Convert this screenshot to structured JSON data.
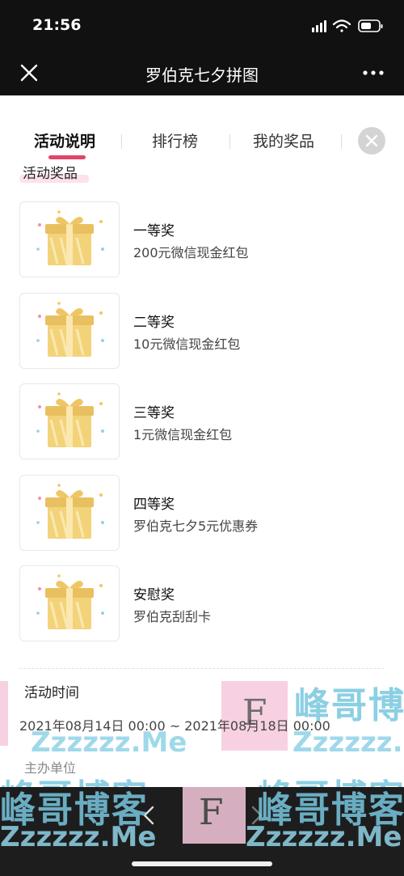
{
  "status_bar": {
    "time": "21:56"
  },
  "nav": {
    "title": "罗伯克七夕拼图"
  },
  "tabs": [
    {
      "label": "活动说明",
      "active": true
    },
    {
      "label": "排行榜",
      "active": false
    },
    {
      "label": "我的奖品",
      "active": false
    }
  ],
  "prizes_section": {
    "label": "活动奖品",
    "items": [
      {
        "name": "一等奖",
        "desc": "200元微信现金红包"
      },
      {
        "name": "二等奖",
        "desc": "10元微信现金红包"
      },
      {
        "name": "三等奖",
        "desc": "1元微信现金红包"
      },
      {
        "name": "四等奖",
        "desc": "罗伯克七夕5元优惠券"
      },
      {
        "name": "安慰奖",
        "desc": "罗伯克刮刮卡"
      }
    ]
  },
  "time_section": {
    "label": "活动时间",
    "value": "2021年08月14日 00:00 ~ 2021年08月18日 00:00"
  },
  "org_section": {
    "label": "主办单位"
  },
  "watermark": {
    "text": "峰哥博客",
    "url": "Zzzzzz.Me",
    "letter": "F",
    "color": "#78c7df"
  },
  "colors": {
    "accent": "#e0456c",
    "gift": "#f3d37a"
  }
}
